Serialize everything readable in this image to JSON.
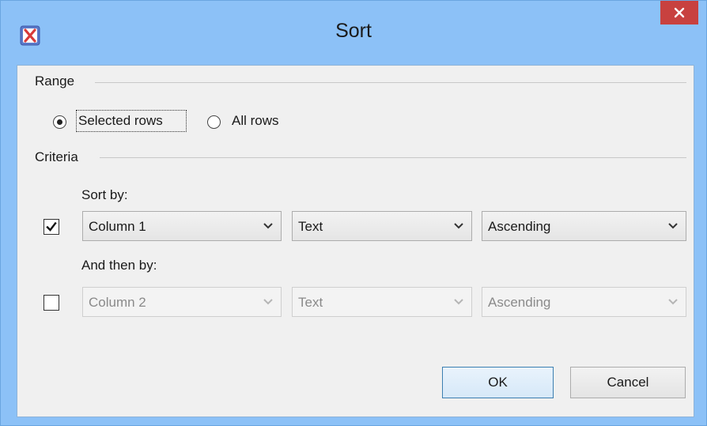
{
  "window": {
    "title": "Sort"
  },
  "range": {
    "label": "Range",
    "options": [
      {
        "label": "Selected rows",
        "selected": true
      },
      {
        "label": "All rows",
        "selected": false
      }
    ]
  },
  "criteria": {
    "label": "Criteria",
    "sort_by": {
      "label": "Sort by:",
      "enabled": true,
      "column": "Column 1",
      "type": "Text",
      "order": "Ascending"
    },
    "then_by": {
      "label": "And then by:",
      "enabled": false,
      "column": "Column 2",
      "type": "Text",
      "order": "Ascending"
    }
  },
  "buttons": {
    "ok": "OK",
    "cancel": "Cancel"
  },
  "icons": {
    "app": "xmind-app-icon",
    "close": "close-icon",
    "dropdown": "chevron-down-icon",
    "check": "check-icon"
  },
  "colors": {
    "titlebar": "#8cc1f7",
    "close_button": "#c8413f",
    "dialog_body": "#f0f0f0",
    "default_button_border": "#3c7fb1"
  }
}
